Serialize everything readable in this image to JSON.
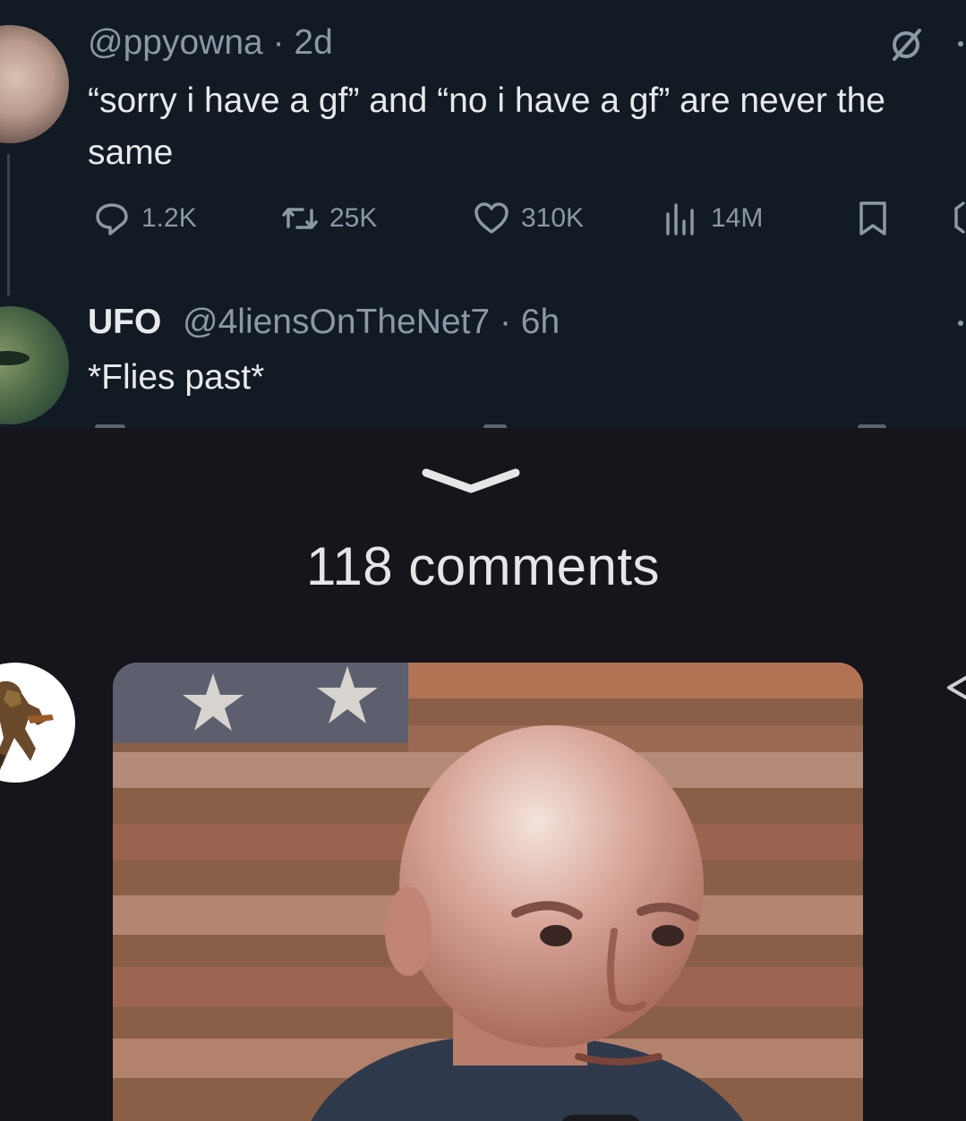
{
  "tweet": {
    "handle": "@ppyowna",
    "separator": "·",
    "time": "2d",
    "text": "“sorry i have a gf” and “no i have a gf” are never the same",
    "actions": {
      "replies": "1.2K",
      "reposts": "25K",
      "likes": "310K",
      "views": "14M"
    }
  },
  "reply": {
    "name": "UFO",
    "handle": "@4liensOnTheNet7",
    "separator": "·",
    "time": "6h",
    "text": "*Flies past*"
  },
  "comments": {
    "count_label": "118 comments"
  },
  "colors": {
    "tweet_bg": "#121a24",
    "app_bg": "#15151b",
    "muted_text": "#8b98a5",
    "primary_text": "#e7e9ea"
  }
}
